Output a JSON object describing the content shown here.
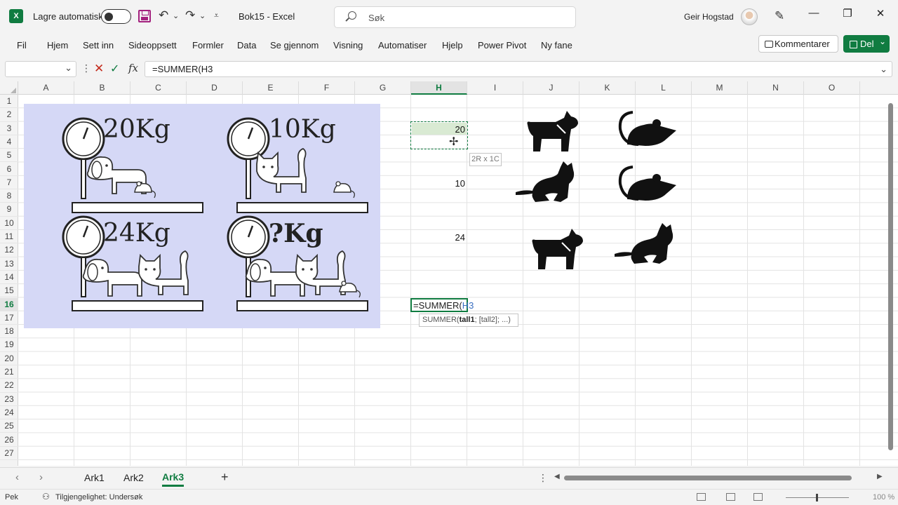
{
  "app": {
    "logo": "X",
    "autosave_label": "Lagre automatisk",
    "doc_title": "Bok15  -  Excel",
    "search_placeholder": "Søk",
    "user_name": "Geir Hogstad"
  },
  "ribbon": {
    "tabs": [
      "Fil",
      "Hjem",
      "Sett inn",
      "Sideoppsett",
      "Formler",
      "Data",
      "Se gjennom",
      "Visning",
      "Automatiser",
      "Hjelp",
      "Power Pivot",
      "Ny fane"
    ],
    "comments_label": "Kommentarer",
    "share_label": "Del"
  },
  "formula_bar": {
    "name_box": "",
    "content": "=SUMMER(H3"
  },
  "grid": {
    "columns": [
      "A",
      "B",
      "C",
      "D",
      "E",
      "F",
      "G",
      "H",
      "I",
      "J",
      "K",
      "L",
      "M",
      "N",
      "O"
    ],
    "selected_column": "H",
    "rows": [
      "1",
      "2",
      "3",
      "4",
      "5",
      "6",
      "7",
      "8",
      "9",
      "10",
      "11",
      "12",
      "13",
      "14",
      "15",
      "16",
      "17",
      "18",
      "19",
      "20",
      "21",
      "22",
      "23",
      "24",
      "25",
      "26",
      "27"
    ],
    "selected_row": "16"
  },
  "picture": {
    "labels": [
      "20Kg",
      "10Kg",
      "24Kg",
      "?Kg"
    ]
  },
  "cells": {
    "H3": "20",
    "H7": "10",
    "H11": "24"
  },
  "range_tooltip": "2R x 1C",
  "active_cell": {
    "formula_prefix": "=SUMMER(",
    "formula_ref": "H3"
  },
  "function_tooltip": {
    "name": "SUMMER(",
    "arg1": "tall1",
    "rest": "; [tall2]; ...)"
  },
  "sheets": {
    "tabs": [
      "Ark1",
      "Ark2",
      "Ark3"
    ],
    "active": "Ark3"
  },
  "status": {
    "mode": "Pek",
    "accessibility": "Tilgjengelighet: Undersøk",
    "zoom": "100 %"
  },
  "colors": {
    "accent": "#107c41",
    "picture_bg": "#d5d8f6",
    "ref_blue": "#3a6fc1"
  }
}
